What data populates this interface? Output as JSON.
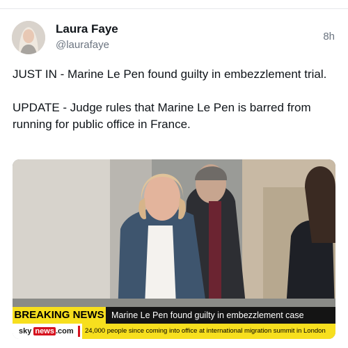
{
  "author": {
    "name": "Laura Faye",
    "handle": "@laurafaye",
    "time": "8h"
  },
  "post": {
    "text": "JUST IN - Marine Le Pen found guilty in embezzlement trial.\n\nUPDATE - Judge rules that Marine Le Pen is barred from running for public office in France."
  },
  "media": {
    "breaking_label": "BREAKING NEWS",
    "headline": "Marine Le Pen found guilty in embezzlement case",
    "logo_prefix": "sky",
    "logo_news": "news",
    "logo_suffix": ".com",
    "ticker": "24,000 people since coming into office at international migration summit in London",
    "colors": {
      "banner_yellow": "#f7df1e",
      "banner_dark": "#141414",
      "brand_red": "#d6111e"
    }
  }
}
